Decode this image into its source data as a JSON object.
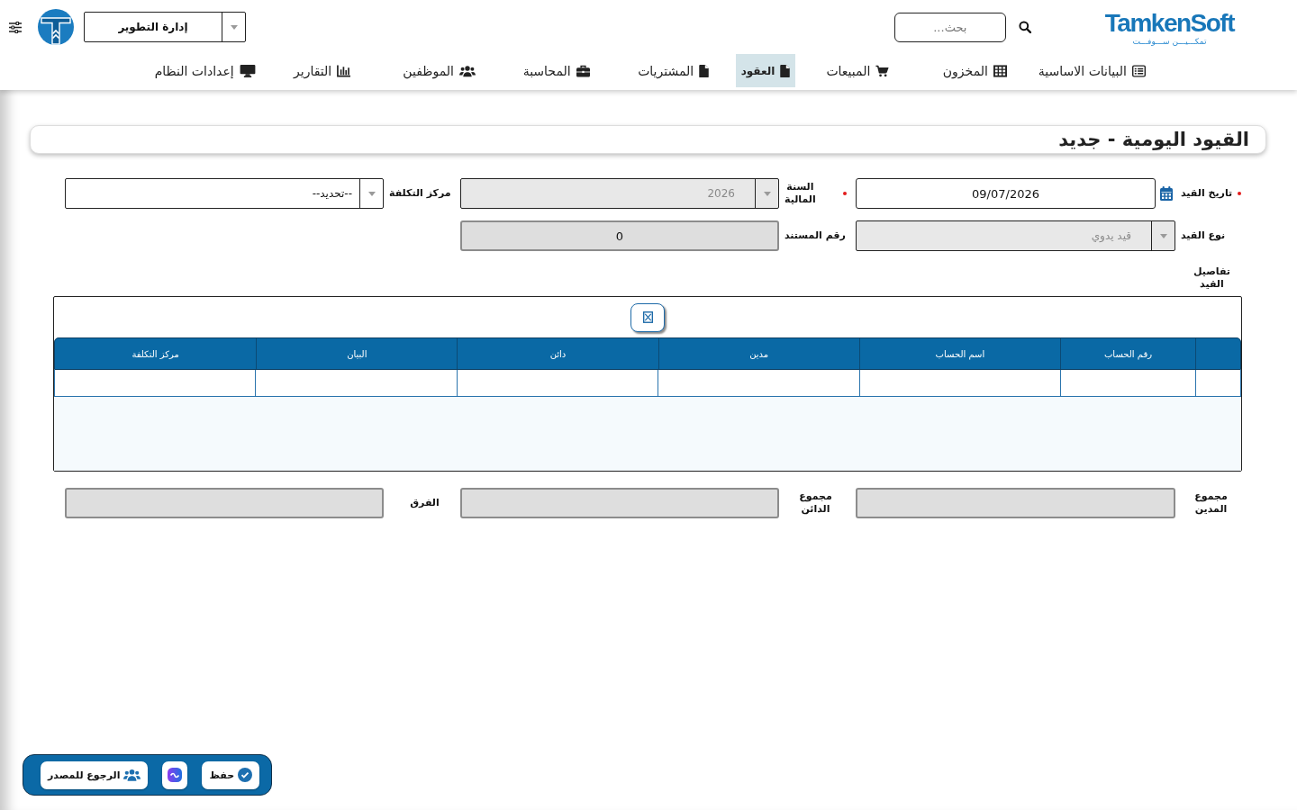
{
  "header": {
    "brand": {
      "name": "TamkenSoft",
      "tagline": "تمكـــيـــن ســـوفـــت"
    },
    "search": {
      "placeholder": "بحث..."
    },
    "department": {
      "value": "إدارة التطوير"
    }
  },
  "nav": [
    {
      "label": "البيانات الاساسية",
      "selected": false
    },
    {
      "label": "المخزون",
      "selected": false
    },
    {
      "label": "المبيعات",
      "selected": false
    },
    {
      "label": "العقود",
      "selected": true
    },
    {
      "label": "المشتريات",
      "selected": false
    },
    {
      "label": "المحاسبة",
      "selected": false
    },
    {
      "label": "الموظفين",
      "selected": false
    },
    {
      "label": "التقارير",
      "selected": false
    },
    {
      "label": "إعدادات النظام",
      "selected": false
    }
  ],
  "page_title": "القيود اليومية - جديد",
  "form": {
    "fields": [
      {
        "label": "تاريخ القيد",
        "kind": "date",
        "required": true,
        "disabled": false,
        "value": "09/07/2026"
      },
      {
        "label": "السنة المالية",
        "kind": "select",
        "required": true,
        "disabled": true,
        "value": "2026"
      },
      {
        "label": "مركز التكلفة",
        "kind": "select",
        "required": false,
        "disabled": false,
        "value": "--تحديد--"
      },
      {
        "label": "نوع القيد",
        "kind": "select",
        "required": false,
        "disabled": true,
        "value": "قيد يدوي"
      },
      {
        "label": "رقم المستند",
        "kind": "text",
        "required": false,
        "disabled": true,
        "value": "0"
      }
    ]
  },
  "details": {
    "label": "تفاصيل القيد",
    "grid": {
      "columns": [
        "رقم الحساب",
        "اسم الحساب",
        "مدين",
        "دائن",
        "البيان",
        "مركز التكلفة"
      ],
      "entry_row": true
    }
  },
  "totals": [
    {
      "label": "مجموع المدين",
      "disabled": true
    },
    {
      "label": "مجموع الدائن",
      "disabled": true
    },
    {
      "label": "الفرق",
      "disabled": true
    }
  ],
  "actions": [
    {
      "kind": "save",
      "label": "حفظ"
    },
    {
      "kind": "app"
    },
    {
      "kind": "back",
      "label": "الرجوع للمصدر"
    }
  ]
}
